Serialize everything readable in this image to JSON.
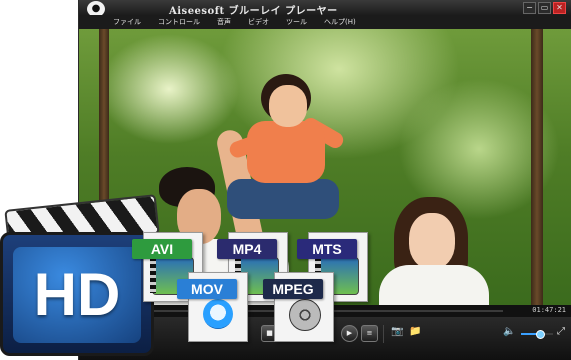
{
  "window": {
    "title": "Aiseesoft ブルーレイ プレーヤー",
    "controls": [
      "−",
      "▭",
      "✕"
    ]
  },
  "menu": {
    "items": [
      "ファイル",
      "コントロール",
      "音声",
      "ビデオ",
      "ツール",
      "ヘルプ(H)"
    ]
  },
  "player": {
    "time": "01:47:21",
    "progress_fraction": 0.0,
    "volume_fraction": 0.6
  },
  "hd_badge": "HD",
  "formats": [
    "AVI",
    "MP4",
    "MTS",
    "MOV",
    "MPEG"
  ],
  "colors": {
    "avi": "#2e9b3e",
    "mp4": "#2b2b6e",
    "mts": "#2a2a7a",
    "mov": "#2a7fd6",
    "mpeg": "#1e2a4a"
  }
}
